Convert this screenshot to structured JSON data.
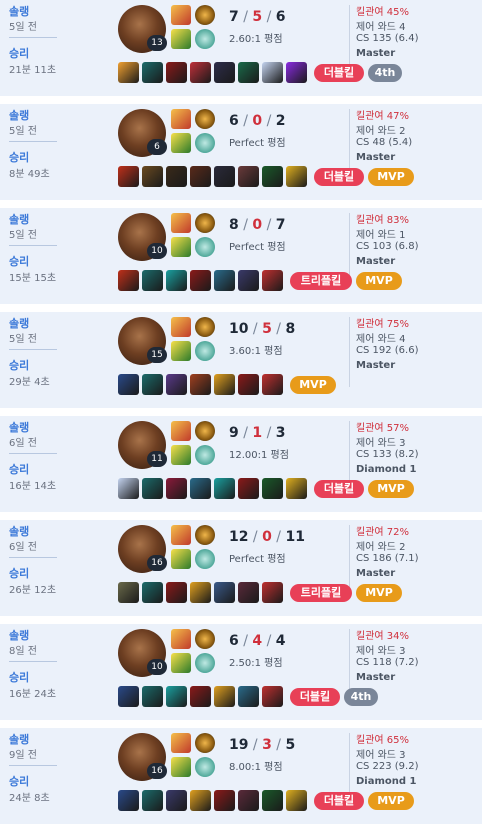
{
  "colors": {
    "card_bg": "#ebf1fa",
    "win_blue": "#3d7ad9",
    "deaths_red": "#d0303c",
    "multikill_red": "#e84057",
    "mvp_gold": "#e89b1a",
    "rank_gray": "#7a8699"
  },
  "matches": [
    {
      "queue": "솔랭",
      "ago": "5일 전",
      "result": "승리",
      "duration": "21분 11초",
      "level": "13",
      "kills": "7",
      "deaths": "5",
      "assists": "6",
      "ratio": "2.60:1 평점",
      "kp": "킬관여 45%",
      "wards": "제어 와드 4",
      "cs": "CS 135 (6.4)",
      "tier": "Master",
      "badges": [
        {
          "text": "더블킬",
          "kind": "red"
        },
        {
          "text": "4th",
          "kind": "gray"
        }
      ],
      "items": [
        "#f0a030",
        "#1b6b6b",
        "#8b1a1a",
        "#c0303a",
        "#2d2d4a",
        "#1a6b4a",
        "#c4d4f0",
        "#8a2be2"
      ]
    },
    {
      "queue": "솔랭",
      "ago": "5일 전",
      "result": "승리",
      "duration": "8분 49초",
      "level": "6",
      "kills": "6",
      "deaths": "0",
      "assists": "2",
      "ratio": "Perfect 평점",
      "kp": "킬관여 47%",
      "wards": "제어 와드 2",
      "cs": "CS 48 (5.4)",
      "tier": "Master",
      "badges": [
        {
          "text": "더블킬",
          "kind": "red"
        },
        {
          "text": "MVP",
          "kind": "mvp"
        }
      ],
      "items": [
        "#c0301a",
        "#6a4a20",
        "#3a2a1a",
        "#5a2a1a",
        "#2a2a3a",
        "#6a3a3a",
        "#1a5a2a",
        "#e0b020"
      ]
    },
    {
      "queue": "솔랭",
      "ago": "5일 전",
      "result": "승리",
      "duration": "15분 15초",
      "level": "10",
      "kills": "8",
      "deaths": "0",
      "assists": "7",
      "ratio": "Perfect 평점",
      "kp": "킬관여 83%",
      "wards": "제어 와드 1",
      "cs": "CS 103 (6.8)",
      "tier": "Master",
      "badges": [
        {
          "text": "트리플킬",
          "kind": "red"
        },
        {
          "text": "MVP",
          "kind": "mvp"
        }
      ],
      "items": [
        "#c0301a",
        "#1b6b6b",
        "#1aa0a0",
        "#8b1a1a",
        "#2a6b8b",
        "#3a3a6a",
        "#c03030"
      ]
    },
    {
      "queue": "솔랭",
      "ago": "5일 전",
      "result": "승리",
      "duration": "29분 4초",
      "level": "15",
      "kills": "10",
      "deaths": "5",
      "assists": "8",
      "ratio": "3.60:1 평점",
      "kp": "킬관여 75%",
      "wards": "제어 와드 4",
      "cs": "CS 192 (6.6)",
      "tier": "Master",
      "badges": [
        {
          "text": "MVP",
          "kind": "mvp"
        }
      ],
      "items": [
        "#2a4a8a",
        "#1b6b6b",
        "#5a3a8a",
        "#a04020",
        "#e0a020",
        "#8b1a1a",
        "#c03030"
      ]
    },
    {
      "queue": "솔랭",
      "ago": "6일 전",
      "result": "승리",
      "duration": "16분 14초",
      "level": "11",
      "kills": "9",
      "deaths": "1",
      "assists": "3",
      "ratio": "12.00:1 평점",
      "kp": "킬관여 57%",
      "wards": "제어 와드 3",
      "cs": "CS 133 (8.2)",
      "tier": "Diamond 1",
      "badges": [
        {
          "text": "더블킬",
          "kind": "red"
        },
        {
          "text": "MVP",
          "kind": "mvp"
        }
      ],
      "items": [
        "#c4d4f0",
        "#1b6b6b",
        "#8b1a3a",
        "#2a6b8b",
        "#1aa0a0",
        "#8b1a1a",
        "#1a5a2a",
        "#e0b020"
      ]
    },
    {
      "queue": "솔랭",
      "ago": "6일 전",
      "result": "승리",
      "duration": "26분 12초",
      "level": "16",
      "kills": "12",
      "deaths": "0",
      "assists": "11",
      "ratio": "Perfect 평점",
      "kp": "킬관여 72%",
      "wards": "제어 와드 2",
      "cs": "CS 186 (7.1)",
      "tier": "Master",
      "badges": [
        {
          "text": "트리플킬",
          "kind": "red"
        },
        {
          "text": "MVP",
          "kind": "mvp"
        }
      ],
      "items": [
        "#6a6a4a",
        "#1b6b6b",
        "#8b1a1a",
        "#e0a020",
        "#3a5a8a",
        "#5a2a3a",
        "#c03030"
      ]
    },
    {
      "queue": "솔랭",
      "ago": "8일 전",
      "result": "승리",
      "duration": "16분 24초",
      "level": "10",
      "kills": "6",
      "deaths": "4",
      "assists": "4",
      "ratio": "2.50:1 평점",
      "kp": "킬관여 34%",
      "wards": "제어 와드 3",
      "cs": "CS 118 (7.2)",
      "tier": "Master",
      "badges": [
        {
          "text": "더블킬",
          "kind": "red"
        },
        {
          "text": "4th",
          "kind": "gray"
        }
      ],
      "items": [
        "#2a4a8a",
        "#1b6b6b",
        "#1aa0a0",
        "#8b1a1a",
        "#e0a020",
        "#2a6b8b",
        "#c03030"
      ]
    },
    {
      "queue": "솔랭",
      "ago": "9일 전",
      "result": "승리",
      "duration": "24분 8초",
      "level": "16",
      "kills": "19",
      "deaths": "3",
      "assists": "5",
      "ratio": "8.00:1 평점",
      "kp": "킬관여 65%",
      "wards": "제어 와드 3",
      "cs": "CS 223 (9.2)",
      "tier": "Diamond 1",
      "badges": [
        {
          "text": "더블킬",
          "kind": "red"
        },
        {
          "text": "MVP",
          "kind": "mvp"
        }
      ],
      "items": [
        "#2a4a8a",
        "#1b6b6b",
        "#3a3a6a",
        "#e0a020",
        "#8b1a1a",
        "#5a2a3a",
        "#1a5a2a",
        "#e0b020"
      ]
    }
  ]
}
